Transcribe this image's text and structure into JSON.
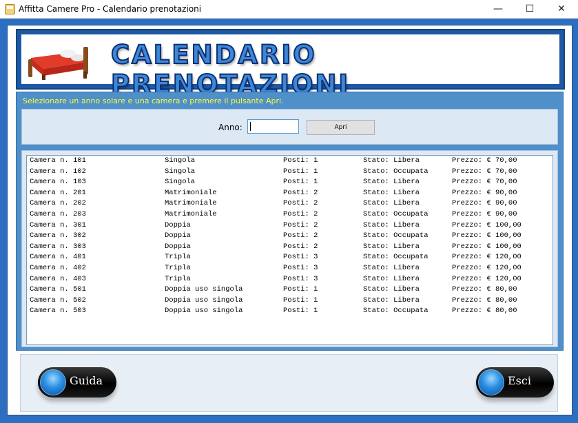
{
  "window": {
    "title": "Affitta Camere Pro - Calendario prenotazioni"
  },
  "titlebar": {
    "minimize": "—",
    "maximize": "☐",
    "close": "✕"
  },
  "header": {
    "title": "CALENDARIO PRENOTAZIONI"
  },
  "hint": "Selezionare un anno solare e una camera e premere il pulsante Apri.",
  "form": {
    "anno_label": "Anno:",
    "anno_value": "",
    "apri_label": "Apri"
  },
  "rooms": [
    {
      "camera": "Camera n. 101",
      "tipo": "Singola",
      "posti": "Posti: 1",
      "stato": "Stato: Libera",
      "prezzo": "Prezzo: € 70,00"
    },
    {
      "camera": "Camera n. 102",
      "tipo": "Singola",
      "posti": "Posti: 1",
      "stato": "Stato: Occupata",
      "prezzo": "Prezzo: € 70,00"
    },
    {
      "camera": "Camera n. 103",
      "tipo": "Singola",
      "posti": "Posti: 1",
      "stato": "Stato: Libera",
      "prezzo": "Prezzo: € 70,00"
    },
    {
      "camera": "Camera n. 201",
      "tipo": "Matrimoniale",
      "posti": "Posti: 2",
      "stato": "Stato: Libera",
      "prezzo": "Prezzo: € 90,00"
    },
    {
      "camera": "Camera n. 202",
      "tipo": "Matrimoniale",
      "posti": "Posti: 2",
      "stato": "Stato: Libera",
      "prezzo": "Prezzo: € 90,00"
    },
    {
      "camera": "Camera n. 203",
      "tipo": "Matrimoniale",
      "posti": "Posti: 2",
      "stato": "Stato: Occupata",
      "prezzo": "Prezzo: € 90,00"
    },
    {
      "camera": "Camera n. 301",
      "tipo": "Doppia",
      "posti": "Posti: 2",
      "stato": "Stato: Libera",
      "prezzo": "Prezzo: € 100,00"
    },
    {
      "camera": "Camera n. 302",
      "tipo": "Doppia",
      "posti": "Posti: 2",
      "stato": "Stato: Occupata",
      "prezzo": "Prezzo: € 100,00"
    },
    {
      "camera": "Camera n. 303",
      "tipo": "Doppia",
      "posti": "Posti: 2",
      "stato": "Stato: Libera",
      "prezzo": "Prezzo: € 100,00"
    },
    {
      "camera": "Camera n. 401",
      "tipo": "Tripla",
      "posti": "Posti: 3",
      "stato": "Stato: Occupata",
      "prezzo": "Prezzo: € 120,00"
    },
    {
      "camera": "Camera n. 402",
      "tipo": "Tripla",
      "posti": "Posti: 3",
      "stato": "Stato: Libera",
      "prezzo": "Prezzo: € 120,00"
    },
    {
      "camera": "Camera n. 403",
      "tipo": "Tripla",
      "posti": "Posti: 3",
      "stato": "Stato: Libera",
      "prezzo": "Prezzo: € 120,00"
    },
    {
      "camera": "Camera n. 501",
      "tipo": "Doppia uso singola",
      "posti": "Posti: 1",
      "stato": "Stato: Libera",
      "prezzo": "Prezzo: € 80,00"
    },
    {
      "camera": "Camera n. 502",
      "tipo": "Doppia uso singola",
      "posti": "Posti: 1",
      "stato": "Stato: Libera",
      "prezzo": "Prezzo: € 80,00"
    },
    {
      "camera": "Camera n. 503",
      "tipo": "Doppia uso singola",
      "posti": "Posti: 1",
      "stato": "Stato: Occupata",
      "prezzo": "Prezzo: € 80,00"
    }
  ],
  "buttons": {
    "guida": "Guida",
    "esci": "Esci"
  },
  "icons": {
    "app": "app-icon",
    "bed": "bed-icon",
    "orb": "blue-orb-icon"
  },
  "colors": {
    "frame": "#2c6fc0",
    "panel": "#4f8fca",
    "hint": "#ffff33",
    "title_fill": "#3c88d6"
  }
}
